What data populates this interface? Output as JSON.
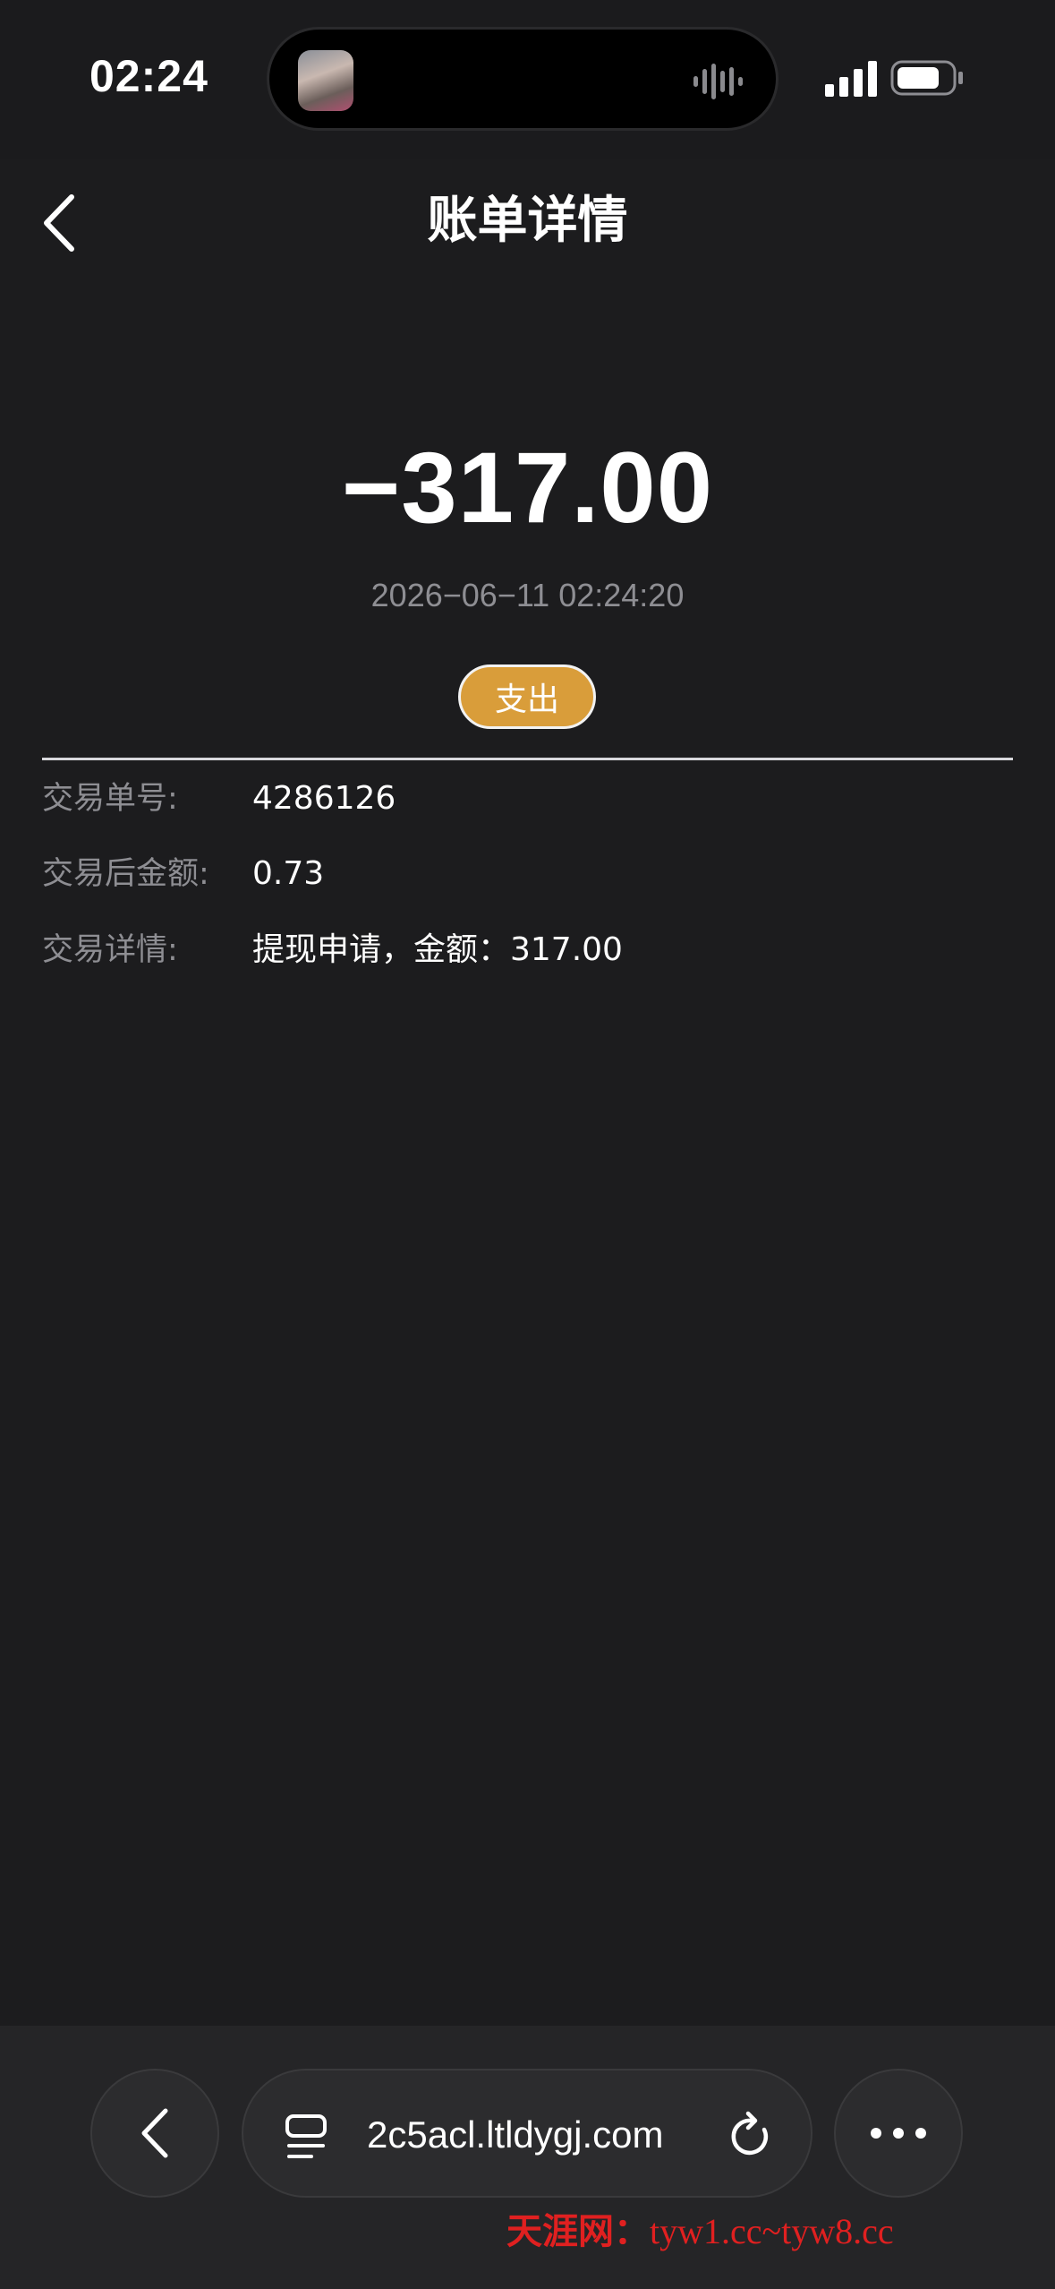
{
  "status_bar": {
    "time": "02:24",
    "icons": [
      "island-avatar-icon",
      "audio-wave-icon",
      "signal-icon",
      "battery-icon"
    ]
  },
  "header": {
    "title": "账单详情",
    "back_icon": "chevron-left-icon"
  },
  "transaction": {
    "amount": "−317.00",
    "datetime": "2026−06−11 02:24:20",
    "type_badge": "支出"
  },
  "details": [
    {
      "label": "交易单号:",
      "value": "4286126"
    },
    {
      "label": "交易后金额:",
      "value": "0.73"
    },
    {
      "label": "交易详情:",
      "value": "提现申请，金额：317.00"
    }
  ],
  "browser": {
    "url": "2c5acl.ltldygj.com",
    "icons": [
      "chevron-left-icon",
      "tabs-icon",
      "reload-icon",
      "more-icon"
    ]
  },
  "watermark": {
    "site_name": "天涯网：",
    "urls": "tyw1.cc~tyw8.cc"
  },
  "colors": {
    "background": "#1c1c1e",
    "badge": "#d99d3a",
    "muted_text": "#8e8e93",
    "watermark": "#e02020"
  }
}
